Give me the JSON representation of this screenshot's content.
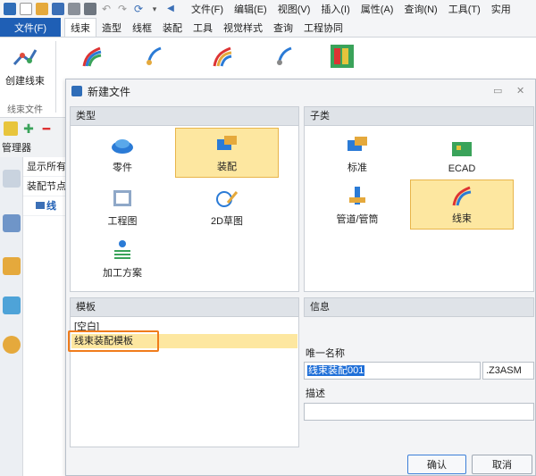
{
  "menubar": {
    "items": [
      "文件(F)",
      "编辑(E)",
      "视图(V)",
      "插入(I)",
      "属性(A)",
      "查询(N)",
      "工具(T)",
      "实用"
    ]
  },
  "ribbon": {
    "file_tab": "文件(F)",
    "tabs": [
      "线束",
      "造型",
      "线框",
      "装配",
      "工具",
      "视觉样式",
      "查询",
      "工程协同"
    ],
    "active_tab": "线束",
    "create_harness_label": "创建线束",
    "group_label": "线束文件"
  },
  "left_panel": {
    "manager_label": "管理器",
    "tree_rows": [
      "显示所有",
      "装配节点",
      "线"
    ]
  },
  "dialog": {
    "title": "新建文件",
    "type_header": "类型",
    "subtype_header": "子类",
    "types": [
      "零件",
      "装配",
      "工程图",
      "2D草图",
      "加工方案"
    ],
    "selected_type": "装配",
    "subtypes": [
      "标准",
      "ECAD",
      "管道/管筒",
      "线束"
    ],
    "selected_subtype": "线束",
    "template_header": "模板",
    "templates": [
      "[空白]",
      "线束装配模板"
    ],
    "selected_template": "线束装配模板",
    "info_header": "信息",
    "unique_name_label": "唯一名称",
    "unique_name_value": "线束装配001",
    "extension": ".Z3ASM",
    "description_label": "描述",
    "description_value": "",
    "ok_label": "确认",
    "cancel_label": "取消"
  },
  "colors": {
    "accent": "#1f5fb5",
    "selection_fill": "#fde7a0",
    "template_highlight_frame": "#f07c1b"
  }
}
